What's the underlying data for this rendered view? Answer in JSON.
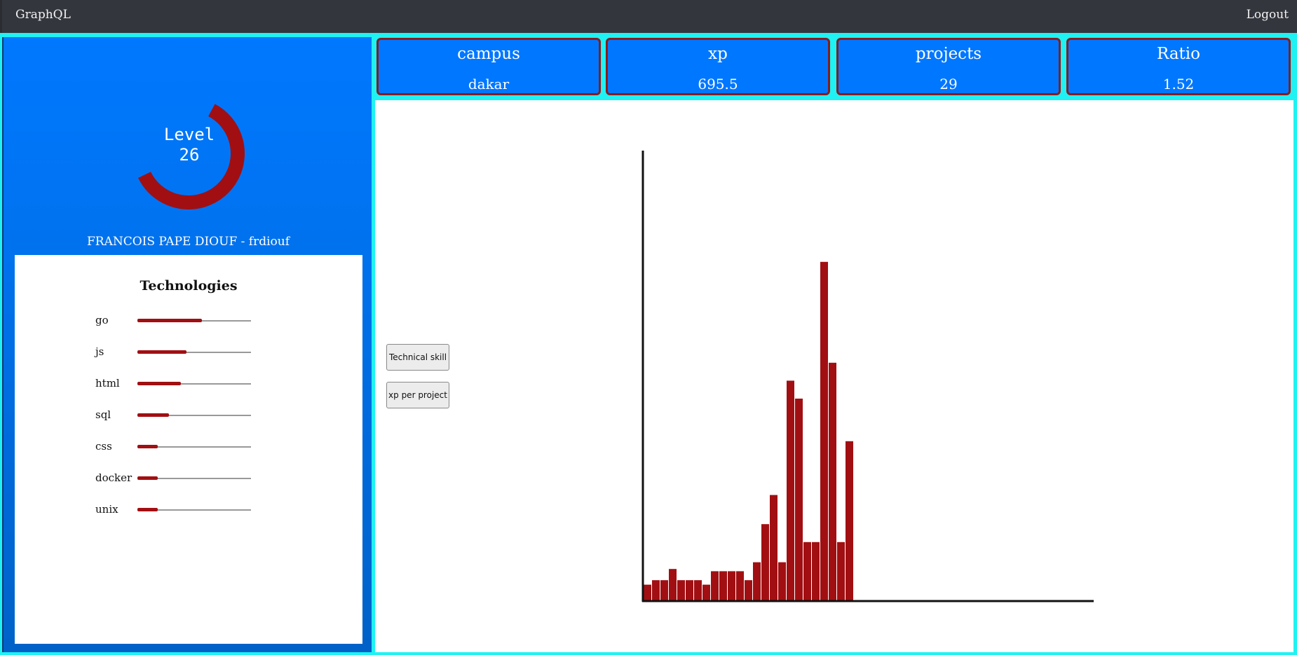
{
  "navbar": {
    "brand": "GraphQL",
    "logout": "Logout"
  },
  "profile": {
    "level_label": "Level",
    "level": "26",
    "level_progress": 0.6,
    "name": "FRANCOIS PAPE DIOUF - frdiouf"
  },
  "technologies": {
    "title": "Technologies",
    "items": [
      {
        "label": "go",
        "value": 0.57
      },
      {
        "label": "js",
        "value": 0.43
      },
      {
        "label": "html",
        "value": 0.38
      },
      {
        "label": "sql",
        "value": 0.28
      },
      {
        "label": "css",
        "value": 0.18
      },
      {
        "label": "docker",
        "value": 0.18
      },
      {
        "label": "unix",
        "value": 0.18
      }
    ]
  },
  "stats": [
    {
      "label": "campus",
      "value": "dakar"
    },
    {
      "label": "xp",
      "value": "695.5"
    },
    {
      "label": "projects",
      "value": "29"
    },
    {
      "label": "Ratio",
      "value": "1.52"
    }
  ],
  "buttons": {
    "technical_skill": "Technical skill",
    "xp_per_project": "xp per project"
  },
  "colors": {
    "accent": "#a10f12",
    "panel_blue": "#0077ff",
    "frame": "#1ff2f2"
  },
  "chart_data": {
    "type": "bar",
    "title": "",
    "xlabel": "",
    "ylabel": "",
    "ylim": [
      0,
      100
    ],
    "values": [
      3.5,
      4.5,
      4.5,
      7,
      4.5,
      4.5,
      4.5,
      3.5,
      6.5,
      6.5,
      6.5,
      6.5,
      4.5,
      8.5,
      17,
      23.5,
      8.5,
      49,
      45,
      13,
      13,
      75.5,
      53,
      13,
      35.5
    ]
  }
}
